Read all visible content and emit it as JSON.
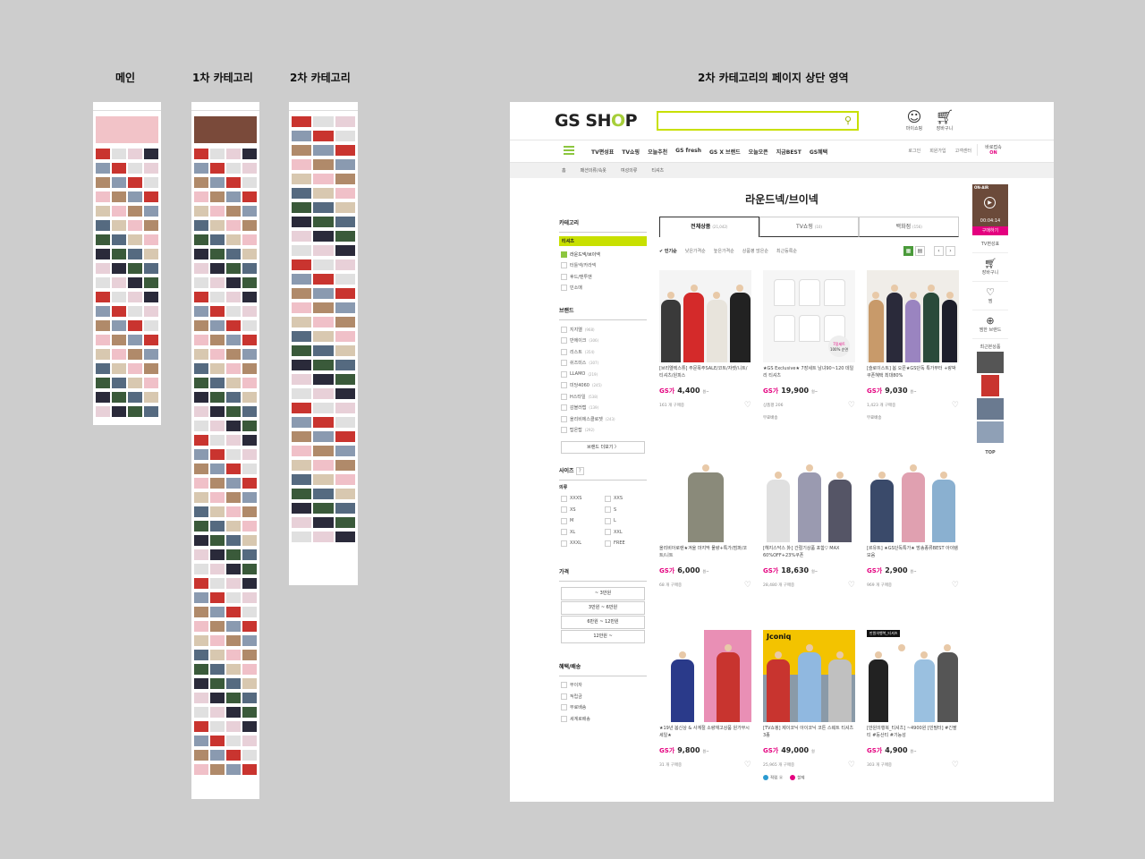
{
  "labels": {
    "main": "메인",
    "cat1": "1차 카테고리",
    "cat2": "2차 카테고리",
    "detail": "2차 카테고리의 페이지 상단 영역"
  },
  "header": {
    "logo_a": "GS SH",
    "logo_o": "O",
    "logo_b": "P",
    "mypage": "마이쇼핑",
    "cart": "장바구니"
  },
  "nav": {
    "items": [
      "TV편성표",
      "TV쇼핑",
      "오늘추천",
      "GS fresh",
      "GS X 브랜드",
      "오늘오픈",
      "지금BEST",
      "GS혜택"
    ],
    "login": "로그인",
    "join": "회원가입",
    "service": "고객센터",
    "baro": "바로접속",
    "on": "ON"
  },
  "breadcrumb": [
    "홈",
    "패션의류/속옷",
    "여성의류",
    "티셔츠"
  ],
  "page_title": "라운드넥/브이넥",
  "sidebar": {
    "category_title": "카테고리",
    "category_selected": "티셔츠",
    "categories": [
      "라운드넥/브이넥",
      "터틀넥/카라넥",
      "후드/맨투맨",
      "민소매"
    ],
    "brand_title": "브랜드",
    "brands": [
      {
        "name": "지지엘",
        "count": "(968)"
      },
      {
        "name": "반에이크",
        "count": "(306)"
      },
      {
        "name": "리스트",
        "count": "(354)"
      },
      {
        "name": "쉬즈미스",
        "count": "(307)"
      },
      {
        "name": "LLAMO",
        "count": "(219)"
      },
      {
        "name": "미당4060",
        "count": "(245)"
      },
      {
        "name": "H스타일",
        "count": "(538)"
      },
      {
        "name": "감블러랩",
        "count": "(139)"
      },
      {
        "name": "올리비에스클로젯",
        "count": "(243)"
      },
      {
        "name": "탑온탑",
        "count": "(292)"
      }
    ],
    "brand_more": "브랜드 더보기 〉",
    "size_title": "사이즈",
    "size_sub": "의류",
    "sizes": [
      "XXXS",
      "XXS",
      "XS",
      "S",
      "M",
      "L",
      "XL",
      "XXL",
      "XXXL",
      "FREE"
    ],
    "price_title": "가격",
    "prices": [
      "~ 3만원",
      "3만원 ~ 6만원",
      "6만원 ~ 12만원",
      "12만원 ~"
    ],
    "benefit_title": "혜택/배송",
    "benefits": [
      "무이자",
      "적립금",
      "무료배송",
      "세계로배송"
    ]
  },
  "tabs": [
    {
      "label": "전체상품",
      "count": "(21,042)"
    },
    {
      "label": "TV쇼핑",
      "count": "(10)"
    },
    {
      "label": "백화점",
      "count": "(156)"
    }
  ],
  "sort": [
    "✔ 인기순",
    "낮은가격순",
    "높은가격순",
    "상품평 많은순",
    "최근등록순"
  ],
  "products": [
    {
      "name": "[브리엘렉스튜] 주문폭주SALE/코트/자켓/니트/티셔츠/원피스",
      "brand": "GS가",
      "price": "4,400",
      "won": "원~",
      "meta": "161 개 구매중",
      "extra": ""
    },
    {
      "name": "★GS Exclusive★ 7장세트 남녀90~120 데일리 티셔츠",
      "brand": "GS가",
      "price": "19,900",
      "won": "원~",
      "meta": "상품평 206",
      "extra": "무료배송"
    },
    {
      "name": "[슬로이스트] 봄 오픈★GS단독 특가부터 +랑박 쿠폰혜택 최대80%",
      "brand": "GS가",
      "price": "9,030",
      "won": "원~",
      "meta": "1,423 개 구매중",
      "extra": "무료배송"
    },
    {
      "name": "올리비아로렌★겨울 마지막 물량+특가/점퍼/코트/니트",
      "brand": "GS가",
      "price": "6,000",
      "won": "원~",
      "meta": "68 개 구매중",
      "extra": ""
    },
    {
      "name": "[헤지스닥스 外] 간절기상품 포함▽ MAX 60%OFF+23%쿠폰",
      "brand": "GS가",
      "price": "18,630",
      "won": "원~",
      "meta": "28,480 개 구매중",
      "extra": ""
    },
    {
      "name": "[르유트] ★GS단독특가★ 방송종류BEST 아이템 모음",
      "brand": "GS가",
      "price": "2,900",
      "won": "원~",
      "meta": "969 개 구매중",
      "extra": ""
    },
    {
      "name": "★19년 봄신상 & 사계절 소량재고상품 원가무시세일★",
      "brand": "GS가",
      "price": "9,800",
      "won": "원~",
      "meta": "31 개 구매중",
      "extra": ""
    },
    {
      "name": "[TV쇼핑] 제이코닉 아이코닉 코튼 스웨트 티셔츠 3종",
      "brand": "GS가",
      "price": "49,000",
      "won": "원",
      "meta": "25,965 개 구매중",
      "extra": ""
    },
    {
      "name": "[만원의행복_티셔츠] ~4900원 [빈필터] #긴팔티 #둥산티 #기능성",
      "brand": "GS가",
      "price": "4,900",
      "won": "원~",
      "meta": "303 개 구매중",
      "extra": ""
    }
  ],
  "product_badges": {
    "point": "적립 ⓪",
    "card": "할제"
  },
  "image_texts": {
    "set7": "7장세트",
    "set7sub": "100% 순면",
    "jconiq": "Jconiq",
    "mantag": "만원의행복_티셔츠"
  },
  "rail": {
    "onair": "ON-AIR",
    "time": "00:04:14",
    "buy": "구매하기",
    "tvsched": "TV편성표",
    "cart": "장바구니",
    "wish": "찜",
    "brand": "찜한 브랜드",
    "recent": "최근본상품",
    "top": "TOP"
  },
  "colors": {
    "accent": "#c8e000",
    "brand_green": "#8cc63f",
    "pink": "#e4007f"
  }
}
